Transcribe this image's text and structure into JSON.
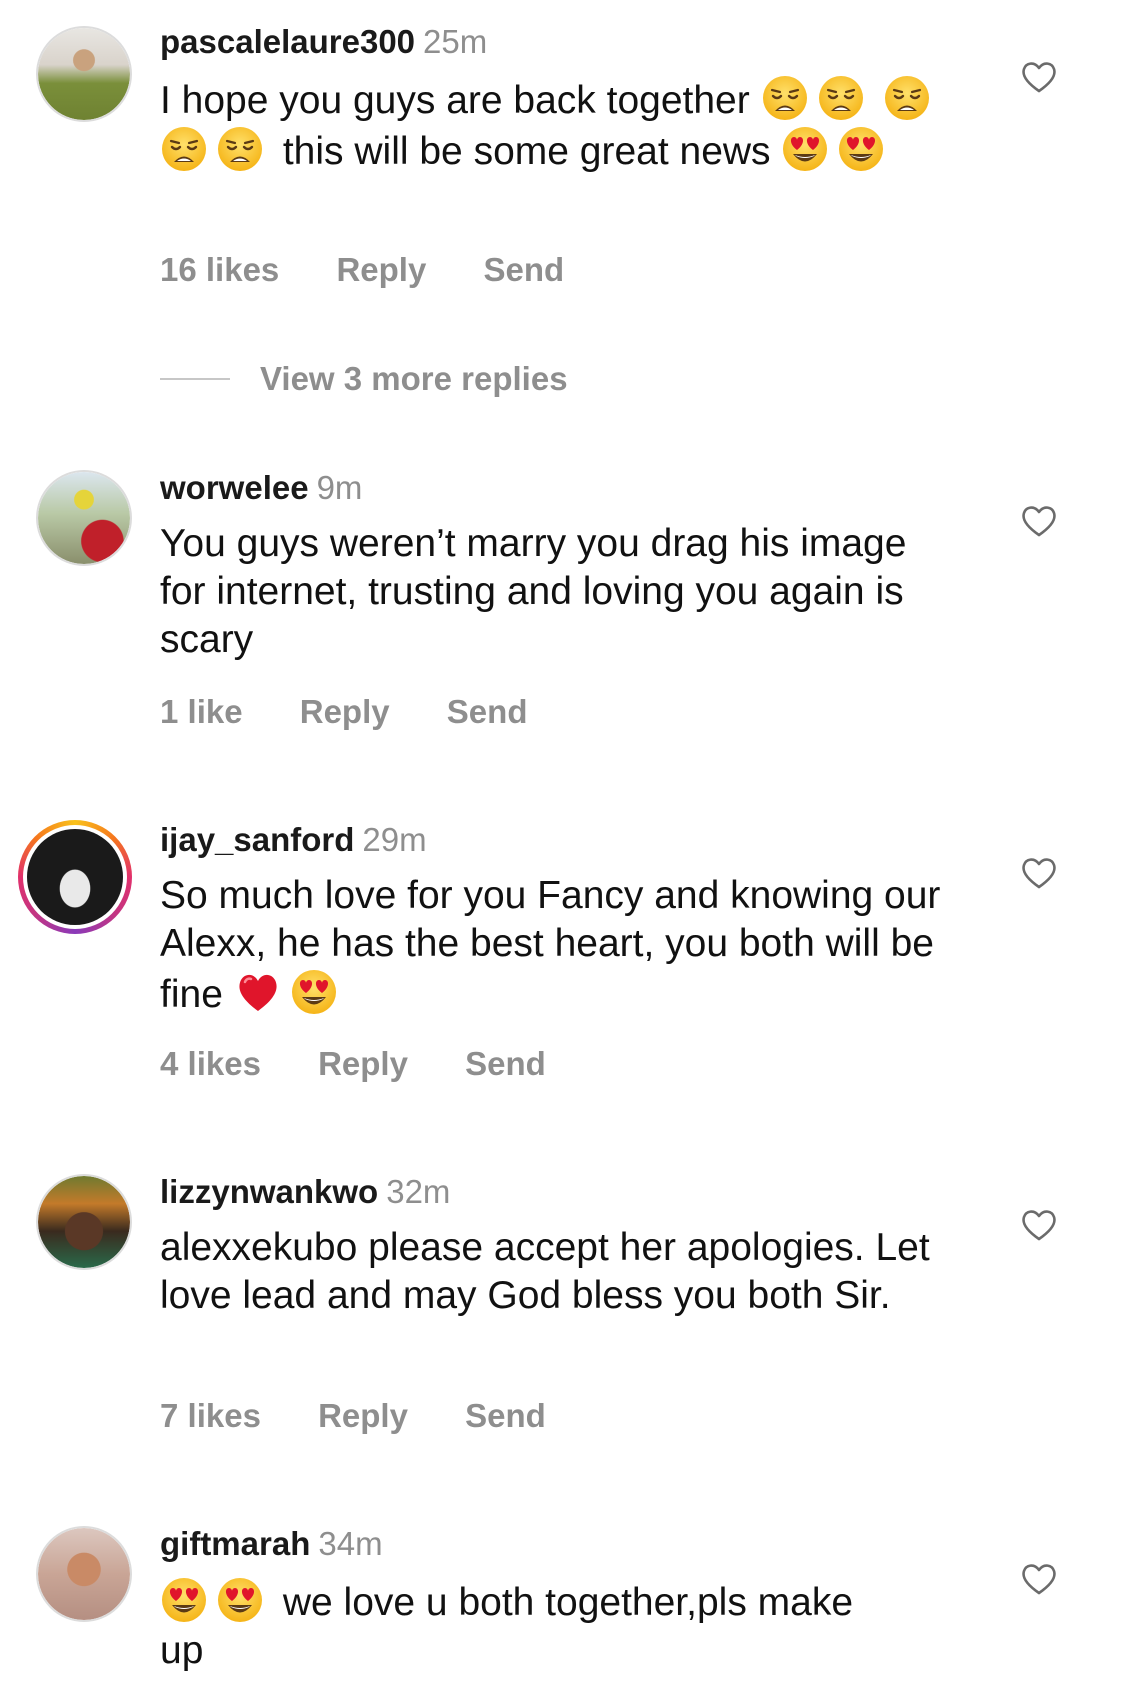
{
  "comments": [
    {
      "username": "pascalelaure300",
      "time": "25m",
      "text_1": "I hope you guys are back together",
      "text_2": "this will be some great news",
      "likes": "16 likes",
      "reply": "Reply",
      "send": "Send",
      "view_replies": "View 3 more replies"
    },
    {
      "username": "worwelee",
      "time": "9m",
      "text": "You guys weren’t marry you drag his image for internet, trusting and loving you again is scary",
      "likes": "1 like",
      "reply": "Reply",
      "send": "Send"
    },
    {
      "username": "ijay_sanford",
      "time": "29m",
      "text": "So much love for you Fancy and knowing our Alexx, he has the best heart, you both will be fine",
      "likes": "4 likes",
      "reply": "Reply",
      "send": "Send"
    },
    {
      "username": "lizzynwankwo",
      "time": "32m",
      "text": "alexxekubo please accept her apologies. Let love lead and may God bless you both Sir.",
      "likes": "7 likes",
      "reply": "Reply",
      "send": "Send"
    },
    {
      "username": "giftmarah",
      "time": "34m",
      "text_1": "we love u both together,pls make",
      "text_2": "up"
    }
  ],
  "icons": {
    "like": "heart-outline-icon",
    "weary": "weary-face-emoji",
    "heart_eyes": "heart-eyes-emoji",
    "red_heart": "red-heart-emoji"
  },
  "colors": {
    "text": "#111111",
    "muted": "#8e8e8e",
    "emoji_face": "#f8c21e",
    "red_heart": "#e0152b",
    "story_ring": "#e1306c"
  }
}
